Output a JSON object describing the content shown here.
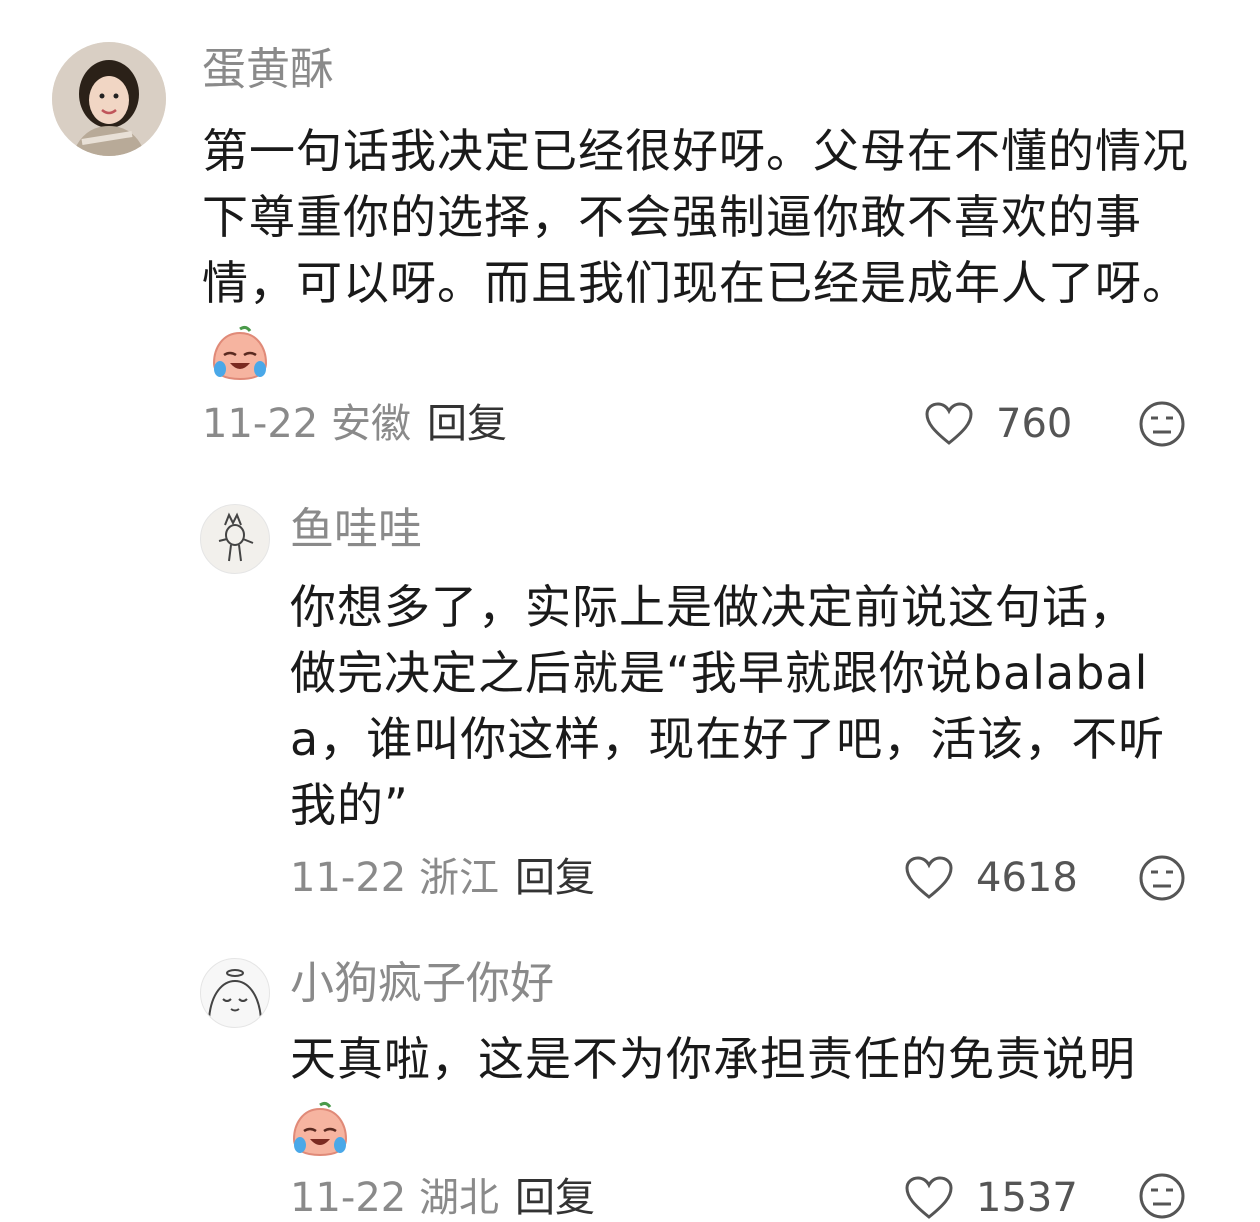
{
  "comments": [
    {
      "username": "蛋黄酥",
      "text": "第一句话我决定已经很好呀。父母在不懂的情况下尊重你的选择，不会强制逼你敢不喜欢的事情，可以呀。而且我们现在已经是成年人了呀。",
      "date_location": "11-22 安徽",
      "reply_label": "回复",
      "likes": "760",
      "emoji": "crying-laughing-peach-emoji"
    },
    {
      "username": "鱼哇哇",
      "text": "你想多了，实际上是做决定前说这句话，做完决定之后就是“我早就跟你说balabala，谁叫你这样，现在好了吧，活该，不听我的”",
      "date_location": "11-22 浙江",
      "reply_label": "回复",
      "likes": "4618"
    },
    {
      "username": "小狗疯子你好",
      "text": "天真啦，这是不为你承担责任的免责说明",
      "date_location": "11-22 湖北",
      "reply_label": "回复",
      "likes": "1537",
      "emoji": "crying-laughing-peach-emoji"
    }
  ],
  "colors": {
    "username": "#8a8a8a",
    "text": "#1a1a1a",
    "meta": "#8a8a8a"
  },
  "icons": [
    "heart-outline-icon",
    "dislike-face-icon"
  ]
}
